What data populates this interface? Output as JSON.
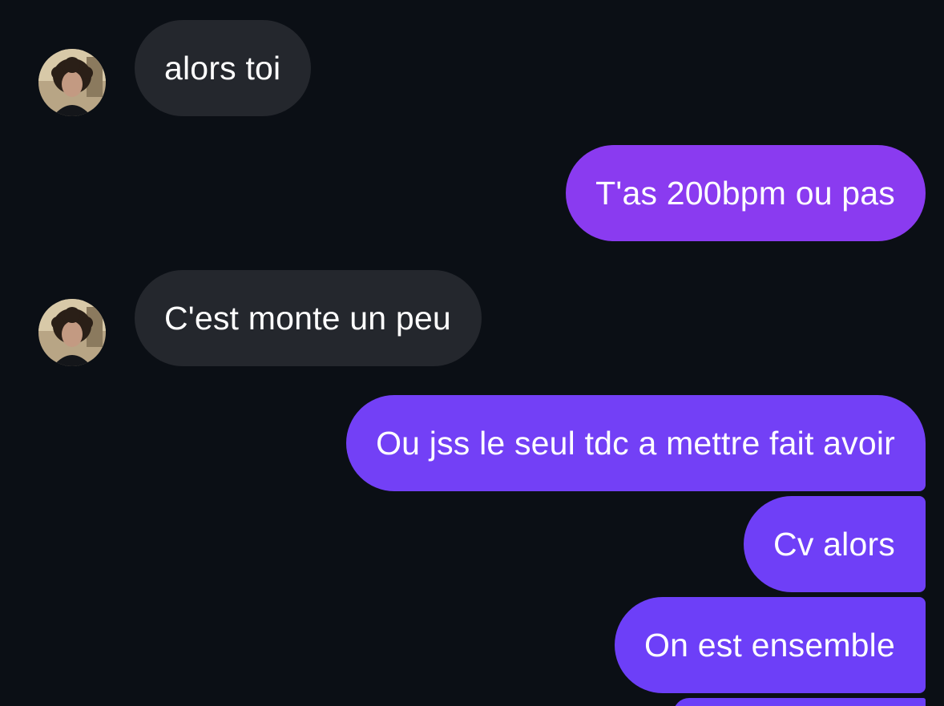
{
  "conversation": {
    "messages": [
      {
        "sender": "them",
        "text": "alors toi"
      },
      {
        "sender": "me",
        "text": "T'as 200bpm ou pas"
      },
      {
        "sender": "them",
        "text": "C'est monte un peu"
      },
      {
        "sender": "me",
        "text": "Ou jss le seul tdc a mettre fait avoir"
      },
      {
        "sender": "me",
        "text": "Cv alors"
      },
      {
        "sender": "me",
        "text": "On est ensemble"
      }
    ]
  },
  "colors": {
    "background": "#0b0f15",
    "incoming_bubble": "#24272d",
    "outgoing_bubble_purple": "#8a3bf0",
    "outgoing_bubble_indigo": "#6d3ff8",
    "text": "#ffffff"
  },
  "icons": {
    "avatar": "contact-avatar-photo"
  }
}
